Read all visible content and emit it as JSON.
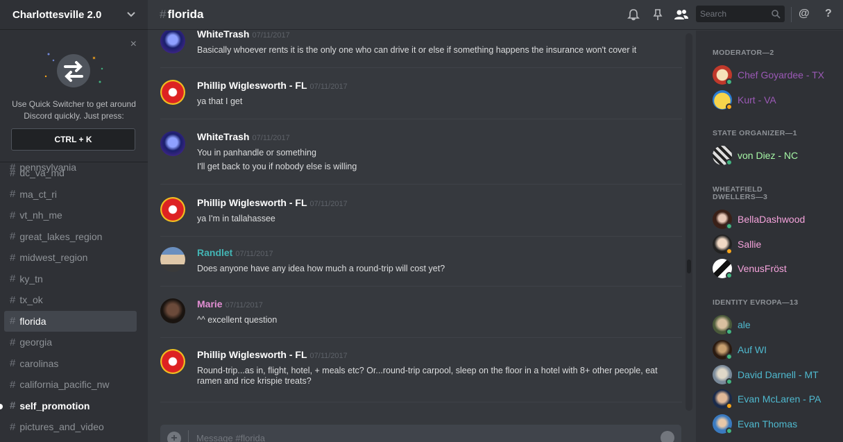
{
  "server": {
    "name": "Charlottesville 2.0"
  },
  "quick_switcher": {
    "text": "Use Quick Switcher to get around Discord quickly. Just press:",
    "shortcut": "CTRL + K",
    "close": "×"
  },
  "channels": [
    {
      "name": "pennsylvania",
      "state": "normal"
    },
    {
      "name": "dc_va_md",
      "state": "normal"
    },
    {
      "name": "ma_ct_ri",
      "state": "normal"
    },
    {
      "name": "vt_nh_me",
      "state": "normal"
    },
    {
      "name": "great_lakes_region",
      "state": "normal"
    },
    {
      "name": "midwest_region",
      "state": "normal"
    },
    {
      "name": "ky_tn",
      "state": "normal"
    },
    {
      "name": "tx_ok",
      "state": "normal"
    },
    {
      "name": "florida",
      "state": "active"
    },
    {
      "name": "georgia",
      "state": "normal"
    },
    {
      "name": "carolinas",
      "state": "normal"
    },
    {
      "name": "california_pacific_nw",
      "state": "normal"
    },
    {
      "name": "self_promotion",
      "state": "unread"
    },
    {
      "name": "pictures_and_video",
      "state": "normal"
    }
  ],
  "header": {
    "channel_name": "florida",
    "hash": "#",
    "search_placeholder": "Search",
    "mention": "@",
    "help": "?"
  },
  "messages": [
    {
      "author": "WhiteTrash",
      "color": "#ffffff",
      "avatar": "wt",
      "timestamp": "07/11/2017",
      "lines": [
        "Basically whoever rents it is the only one who can drive it or else if something happens the insurance won't cover it"
      ]
    },
    {
      "author": "Phillip Wiglesworth - FL",
      "color": "#ffffff",
      "avatar": "kc",
      "timestamp": "07/11/2017",
      "lines": [
        "ya that I get"
      ]
    },
    {
      "author": "WhiteTrash",
      "color": "#ffffff",
      "avatar": "wt",
      "timestamp": "07/11/2017",
      "lines": [
        "You in panhandle or something",
        "I'll get back to you if nobody else is willing"
      ]
    },
    {
      "author": "Phillip Wiglesworth - FL",
      "color": "#ffffff",
      "avatar": "kc",
      "timestamp": "07/11/2017",
      "lines": [
        "ya I'm in tallahassee"
      ]
    },
    {
      "author": "Randlet",
      "color": "#43b5b5",
      "avatar": "rd",
      "timestamp": "07/11/2017",
      "lines": [
        "Does anyone have any idea how much a round-trip will cost yet?"
      ]
    },
    {
      "author": "Marie",
      "color": "#e48fd5",
      "avatar": "mr",
      "timestamp": "07/11/2017",
      "lines": [
        "^^ excellent question"
      ]
    },
    {
      "author": "Phillip Wiglesworth - FL",
      "color": "#ffffff",
      "avatar": "kc",
      "timestamp": "07/11/2017",
      "lines": [
        "Round-trip...as in, flight, hotel, + meals etc? Or...round-trip carpool, sleep on the floor in a hotel with 8+ other people, eat ramen and rice krispie treats?"
      ]
    }
  ],
  "composer": {
    "placeholder": "Message #florida",
    "plus": "+"
  },
  "member_groups": [
    {
      "label": "MODERATOR—2",
      "members": [
        {
          "name": "Chef Goyardee - TX",
          "color": "#9b59b6",
          "status": "online",
          "avatar": "chef"
        },
        {
          "name": "Kurt - VA",
          "color": "#9b59b6",
          "status": "idle",
          "avatar": "kurt"
        }
      ]
    },
    {
      "label": "STATE ORGANIZER—1",
      "members": [
        {
          "name": "von Diez - NC",
          "color": "#a6f7a6",
          "status": "online",
          "avatar": "vd"
        }
      ]
    },
    {
      "label": "WHEATFIELD DWELLERS—3",
      "members": [
        {
          "name": "BellaDashwood",
          "color": "#f5a3dc",
          "status": "online",
          "avatar": "bd"
        },
        {
          "name": "Sallie",
          "color": "#f5a3dc",
          "status": "idle",
          "avatar": "sl"
        },
        {
          "name": "VenusFröst",
          "color": "#f5a3dc",
          "status": "online",
          "avatar": "vf"
        }
      ]
    },
    {
      "label": "IDENTITY EVROPA—13",
      "members": [
        {
          "name": "ale",
          "color": "#4fb9cf",
          "status": "online",
          "avatar": "al"
        },
        {
          "name": "Auf WI",
          "color": "#4fb9cf",
          "status": "online",
          "avatar": "aw"
        },
        {
          "name": "David Darnell - MT",
          "color": "#4fb9cf",
          "status": "online",
          "avatar": "dd"
        },
        {
          "name": "Evan McLaren - PA",
          "color": "#4fb9cf",
          "status": "idle",
          "avatar": "em"
        },
        {
          "name": "Evan Thomas",
          "color": "#4fb9cf",
          "status": "online",
          "avatar": "et"
        }
      ]
    }
  ],
  "status_colors": {
    "online": "#43b581",
    "idle": "#faa61a"
  }
}
